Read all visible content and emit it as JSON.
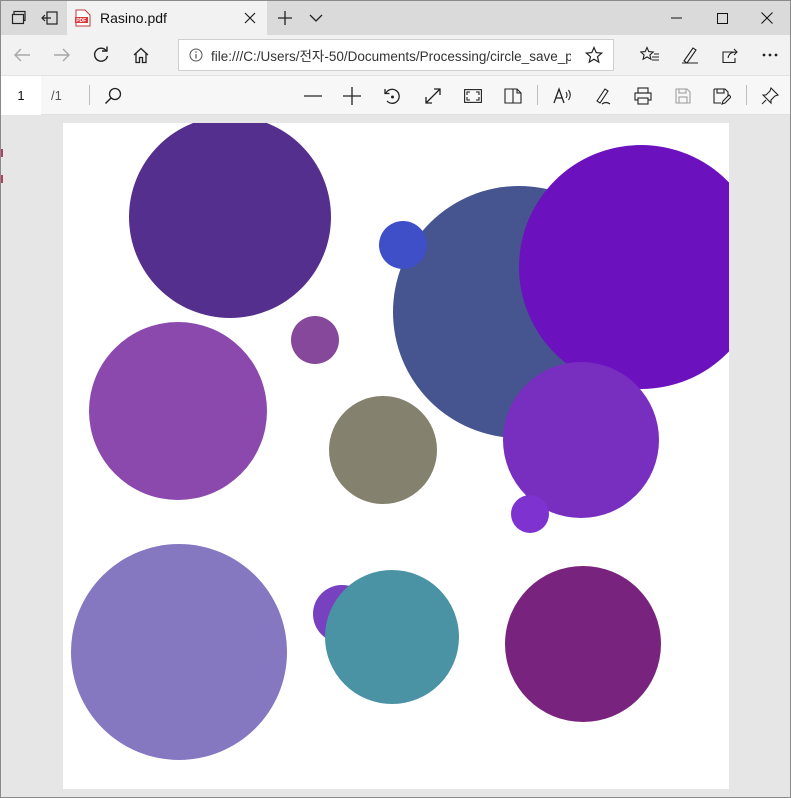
{
  "tab": {
    "title": "Rasino.pdf"
  },
  "address": {
    "url": "file:///C:/Users/전자-50/Documents/Processing/circle_save_pdf/R"
  },
  "pdf_toolbar": {
    "page_current": "1",
    "page_total": "/1"
  },
  "colors": {
    "titlebar_bg": "#dadada",
    "toolbar_bg": "#f2f2f2",
    "viewer_bg": "#e6e6e6",
    "page_bg": "#ffffff"
  },
  "icons": [
    "tabs-aside-icon",
    "set-aside-icon",
    "pdf-file-icon",
    "close-tab-icon",
    "new-tab-icon",
    "tab-list-chevron-icon",
    "minimize-icon",
    "maximize-icon",
    "close-window-icon",
    "back-arrow-icon",
    "forward-arrow-icon",
    "refresh-icon",
    "home-icon",
    "info-icon",
    "favorite-star-icon",
    "favorites-list-icon",
    "pen-notes-icon",
    "share-icon",
    "more-icon",
    "search-icon",
    "zoom-out-icon",
    "zoom-in-icon",
    "rotate-icon",
    "fit-page-icon",
    "full-screen-icon",
    "page-view-icon",
    "read-aloud-icon",
    "draw-icon",
    "print-icon",
    "save-icon",
    "save-as-icon",
    "pin-toolbar-icon"
  ],
  "circles": [
    {
      "name": "circle-dark-purple-top",
      "color": "#542f8d"
    },
    {
      "name": "circle-violet-right",
      "color": "#6b12be"
    },
    {
      "name": "circle-slate-blue",
      "color": "#46548f"
    },
    {
      "name": "circle-small-blue",
      "color": "#3f4fc8"
    },
    {
      "name": "circle-small-plum",
      "color": "#86489b"
    },
    {
      "name": "circle-orchid-left",
      "color": "#8b49ad"
    },
    {
      "name": "circle-olive-gray",
      "color": "#84816e"
    },
    {
      "name": "circle-purple-mid-right",
      "color": "#782fbf"
    },
    {
      "name": "circle-tiny-purple",
      "color": "#7e32cf"
    },
    {
      "name": "circle-lavender-large",
      "color": "#8577c0"
    },
    {
      "name": "circle-small-indigo",
      "color": "#7841bf"
    },
    {
      "name": "circle-teal",
      "color": "#4a93a4"
    },
    {
      "name": "circle-magenta-dark",
      "color": "#78237d"
    }
  ]
}
